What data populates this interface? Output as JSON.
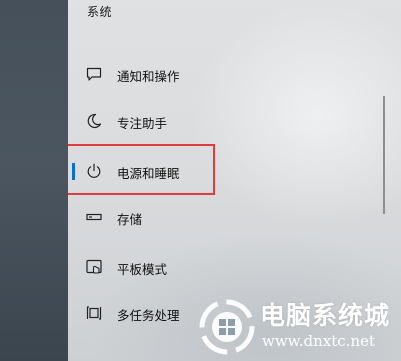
{
  "settings": {
    "section_title": "系统",
    "items": [
      {
        "label": "通知和操作",
        "icon": "notification-icon"
      },
      {
        "label": "专注助手",
        "icon": "moon-icon"
      },
      {
        "label": "电源和睡眠",
        "icon": "power-icon",
        "selected": true
      },
      {
        "label": "存储",
        "icon": "storage-icon"
      },
      {
        "label": "平板模式",
        "icon": "tablet-mode-icon"
      },
      {
        "label": "多任务处理",
        "icon": "multitasking-icon"
      }
    ],
    "accent_color": "#0b6fd0",
    "highlight_color": "#e33b3b"
  },
  "watermark": {
    "title": "电脑系统城",
    "url": "www.dnxtc.net"
  }
}
